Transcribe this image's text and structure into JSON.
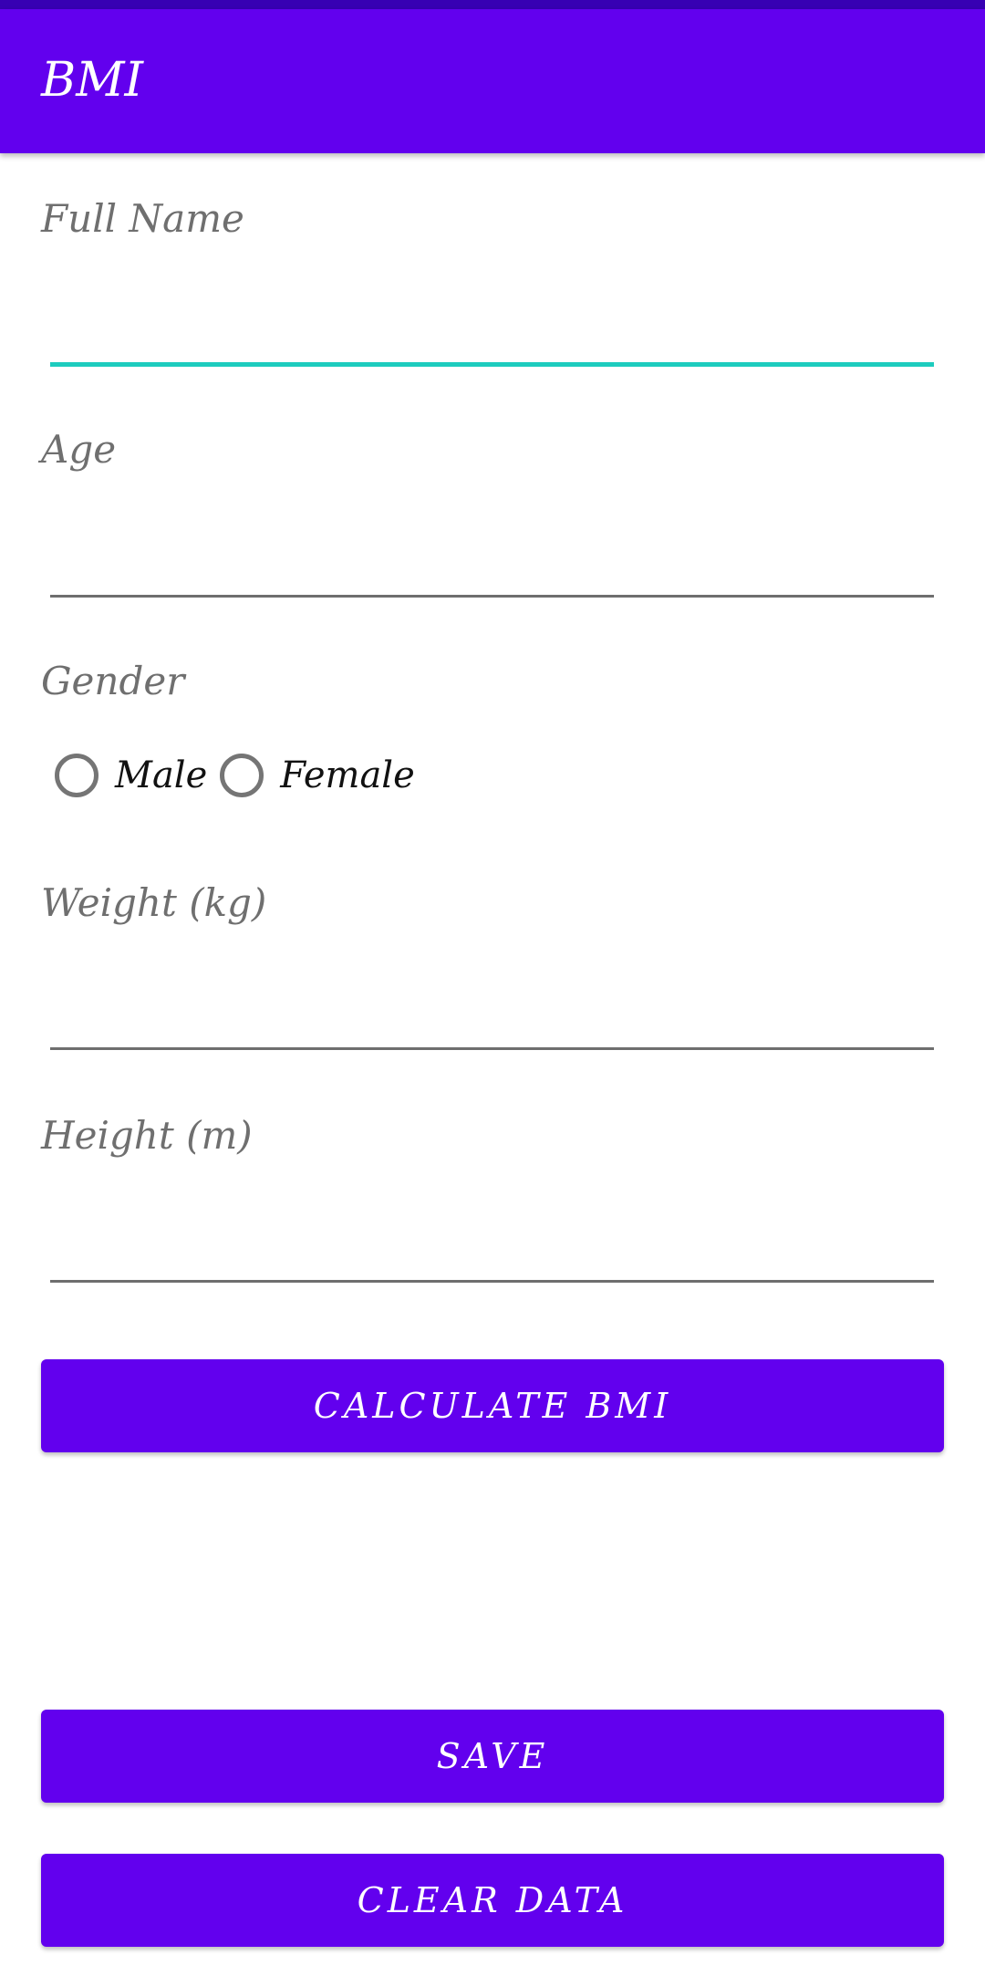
{
  "app_bar": {
    "title": "BMI"
  },
  "form": {
    "full_name": {
      "label": "Full Name",
      "value": ""
    },
    "age": {
      "label": "Age",
      "value": ""
    },
    "gender": {
      "label": "Gender",
      "options": [
        "Male",
        "Female"
      ],
      "selected": null
    },
    "weight": {
      "label": "Weight (kg)",
      "value": ""
    },
    "height": {
      "label": "Height (m)",
      "value": ""
    }
  },
  "buttons": {
    "calculate": "CALCULATE BMI",
    "save": "SAVE",
    "clear": "CLEAR DATA"
  },
  "colors": {
    "primary": "#6200EE",
    "status_bar": "#3700B3",
    "focus_accent": "#1DCCBE"
  }
}
